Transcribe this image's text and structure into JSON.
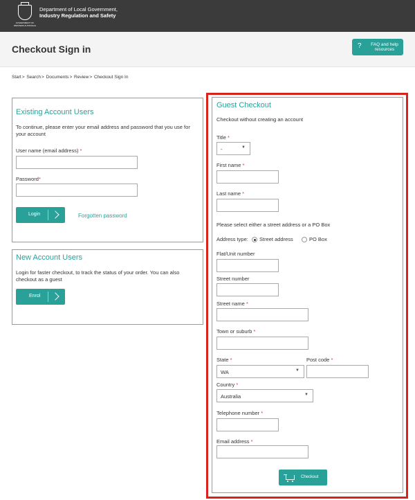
{
  "header": {
    "crest_text": "GOVERNMENT OF WESTERN AUSTRALIA",
    "dept_line1": "Department of Local Government,",
    "dept_line2": "Industry Regulation and Safety"
  },
  "titlebar": {
    "title": "Checkout Sign in",
    "faq_label": "FAQ and help resources"
  },
  "breadcrumb": [
    "Start",
    "Search",
    "Documents",
    "Review",
    "Checkout Sign In"
  ],
  "existing": {
    "title": "Existing Account Users",
    "intro": "To continue, please enter your email address and password that you use for your account",
    "username_label": "User name (email address)",
    "password_label": "Password",
    "login_label": "Login",
    "forgot_label": "Forgotten password"
  },
  "newacct": {
    "title": "New Account Users",
    "intro": "Login for faster checkout, to track the status of your order. You can also checkout as a guest",
    "enrol_label": "Enrol"
  },
  "guest": {
    "title": "Guest Checkout",
    "intro": "Checkout without creating an account",
    "title_label": "Title",
    "title_value": "-",
    "first_name_label": "First name",
    "last_name_label": "Last name",
    "address_note": "Please select either a street address or a PO Box",
    "address_type_label": "Address type:",
    "street_option": "Street address",
    "po_option": "PO Box",
    "flat_label": "Flat/Unit number",
    "street_number_label": "Street number",
    "street_name_label": "Street name",
    "town_label": "Town or suburb",
    "state_label": "State",
    "state_value": "WA",
    "postcode_label": "Post code",
    "country_label": "Country",
    "country_value": "Australia",
    "phone_label": "Telephone number",
    "email_label": "Email address",
    "checkout_label": "Checkout"
  },
  "colors": {
    "accent": "#2aa198",
    "header": "#3b3b3b",
    "highlight": "#d9221c"
  }
}
